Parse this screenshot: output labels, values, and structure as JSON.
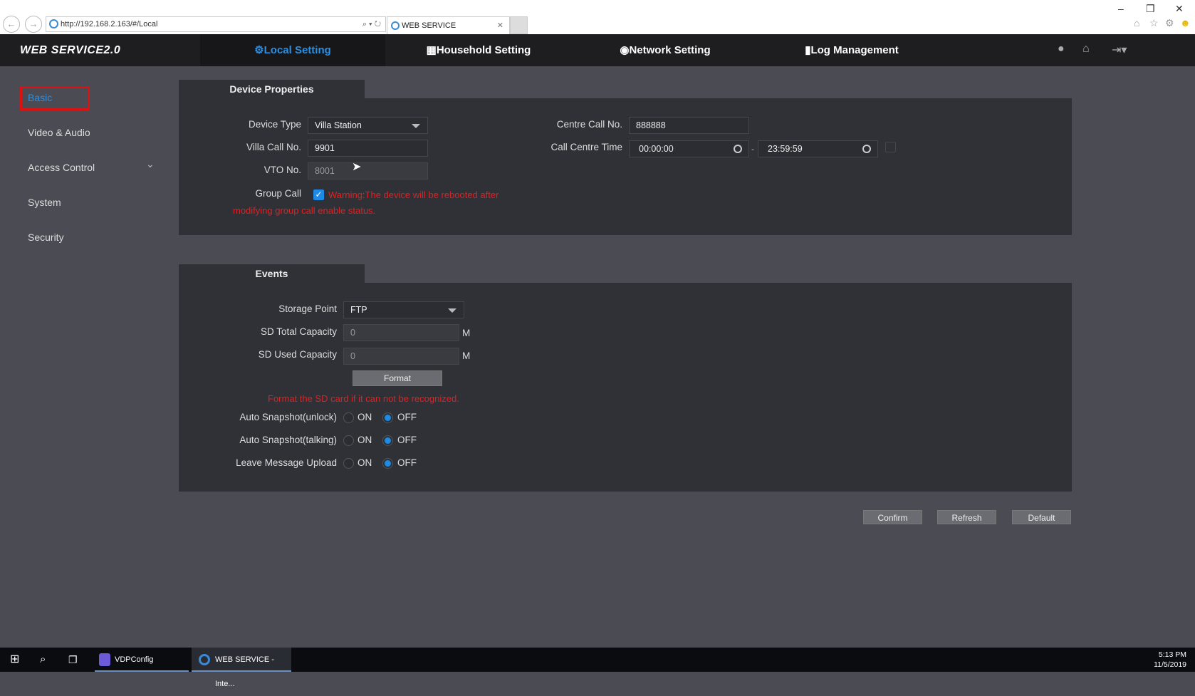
{
  "browser": {
    "url": "http://192.168.2.163/#/Local",
    "tab_title": "WEB SERVICE"
  },
  "header": {
    "logo": "WEB SERVICE2.0",
    "nav": [
      {
        "label": "Local Setting",
        "active": true
      },
      {
        "label": "Household Setting"
      },
      {
        "label": "Network Setting"
      },
      {
        "label": "Log Management"
      }
    ]
  },
  "sidebar": {
    "items": [
      {
        "label": "Basic",
        "active": true
      },
      {
        "label": "Video & Audio"
      },
      {
        "label": "Access Control"
      },
      {
        "label": "System"
      },
      {
        "label": "Security"
      }
    ]
  },
  "device_properties": {
    "title": "Device Properties",
    "device_type_label": "Device Type",
    "device_type": "Villa Station",
    "villa_call_label": "Villa Call No.",
    "villa_call": "9901",
    "vto_label": "VTO No.",
    "vto": "8001",
    "group_call_label": "Group Call",
    "group_call_checked": true,
    "warning_line1": "Warning:The device will be rebooted after",
    "warning_line2": "modifying group call enable status.",
    "centre_call_label": "Centre Call No.",
    "centre_call": "888888",
    "call_time_label": "Call Centre Time",
    "call_time_start": "00:00:00",
    "call_time_sep": "-",
    "call_time_end": "23:59:59"
  },
  "events": {
    "title": "Events",
    "storage_label": "Storage Point",
    "storage": "FTP",
    "sd_total_label": "SD Total Capacity",
    "sd_total": "0",
    "sd_used_label": "SD Used Capacity",
    "sd_used": "0",
    "unit": "M",
    "format_label": "Format",
    "format_hint": "Format the SD card if it can not be recognized.",
    "on": "ON",
    "off": "OFF",
    "options": [
      {
        "label": "Auto Snapshot(unlock)",
        "value": "OFF"
      },
      {
        "label": "Auto Snapshot(talking)",
        "value": "OFF"
      },
      {
        "label": "Leave Message Upload",
        "value": "OFF"
      }
    ]
  },
  "actions": {
    "confirm": "Confirm",
    "refresh": "Refresh",
    "default": "Default"
  },
  "taskbar": {
    "apps": [
      "VDPConfig",
      "WEB SERVICE - Inte..."
    ],
    "time": "5:13 PM",
    "date": "11/5/2019"
  }
}
